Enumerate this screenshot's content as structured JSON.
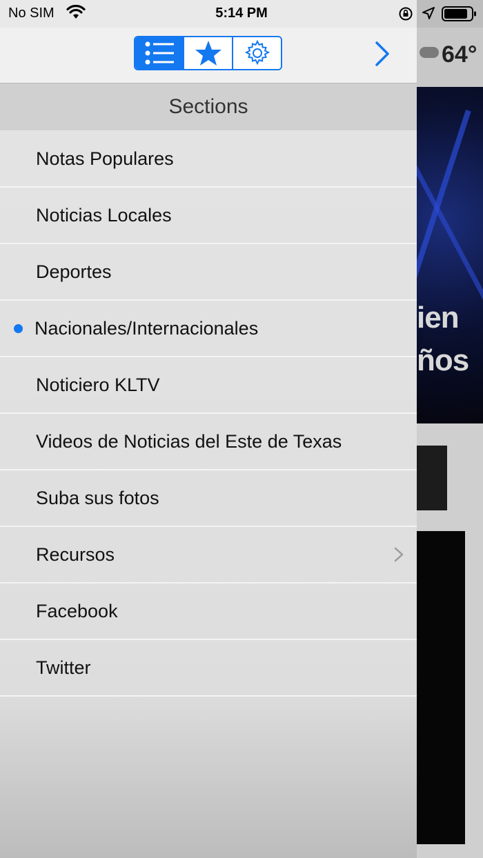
{
  "status_bar": {
    "carrier": "No SIM",
    "time": "5:14 PM"
  },
  "toolbar": {
    "tabs": [
      {
        "icon": "list-icon",
        "active": true
      },
      {
        "icon": "star-icon",
        "active": false
      },
      {
        "icon": "gear-icon",
        "active": false
      }
    ],
    "forward_icon": "chevron-right-icon"
  },
  "sections": {
    "title": "Sections",
    "items": [
      {
        "label": "Notas Populares"
      },
      {
        "label": "Noticias Locales"
      },
      {
        "label": "Deportes"
      },
      {
        "label": "Nacionales/Internacionales",
        "selected": true
      },
      {
        "label": "Noticiero KLTV"
      },
      {
        "label": "Videos de Noticias del Este de Texas"
      },
      {
        "label": "Suba sus fotos"
      },
      {
        "label": "Recursos",
        "has_submenu": true
      },
      {
        "label": "Facebook"
      },
      {
        "label": "Twitter"
      }
    ]
  },
  "background_app": {
    "temperature": "64°",
    "headline_fragment_1": "ien",
    "headline_fragment_2": "ños"
  },
  "colors": {
    "accent": "#1478f0",
    "header_bg": "#d0d0d0"
  }
}
